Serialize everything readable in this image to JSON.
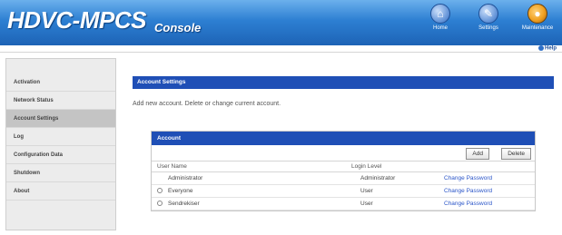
{
  "header": {
    "brand": "HDVC-MPCS",
    "subtitle": "Console",
    "icons": [
      {
        "label": "Home",
        "icon": "home-icon"
      },
      {
        "label": "Settings",
        "icon": "compass-icon"
      },
      {
        "label": "Maintenance",
        "icon": "gear-icon"
      }
    ],
    "help": "Help"
  },
  "sidebar": {
    "items": [
      {
        "label": "Activation"
      },
      {
        "label": "Network Status"
      },
      {
        "label": "Account Settings",
        "active": true
      },
      {
        "label": "Log"
      },
      {
        "label": "Configuration Data"
      },
      {
        "label": "Shutdown"
      },
      {
        "label": "About"
      }
    ]
  },
  "main": {
    "title": "Account Settings",
    "description": "Add new account. Delete or change current account.",
    "panel": {
      "title": "Account",
      "add_label": "Add",
      "delete_label": "Delete",
      "columns": [
        "User Name",
        "Login Level",
        ""
      ],
      "rows": [
        {
          "name": "Administrator",
          "level": "Administrator",
          "action": "Change Password",
          "radio": false
        },
        {
          "name": "Everyone",
          "level": "User",
          "action": "Change Password",
          "radio": true
        },
        {
          "name": "Sendrekiser",
          "level": "User",
          "action": "Change Password",
          "radio": true
        }
      ]
    }
  },
  "colors": {
    "header_blue": "#2d7fd2",
    "title_bar": "#1f4fb6",
    "link": "#2a55c8",
    "sidebar_active": "#c4c4c4"
  }
}
